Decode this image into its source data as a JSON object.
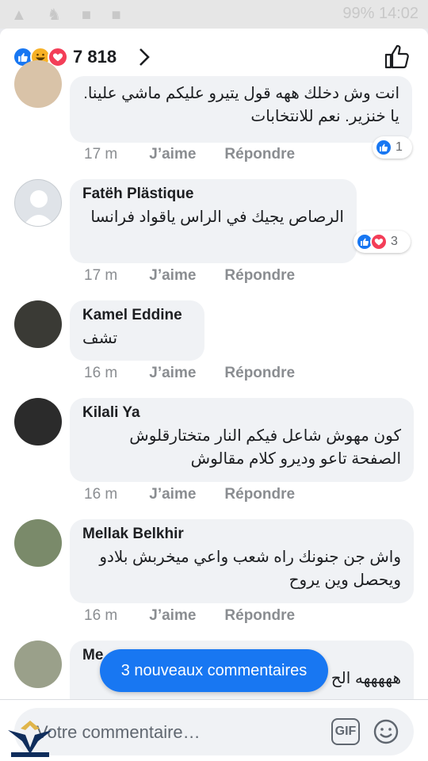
{
  "status": {
    "left_icons": "▲ ♞ ■ ■",
    "right_text": "99% 14:02"
  },
  "header": {
    "reaction_icons": [
      "like-icon",
      "haha-icon",
      "love-icon"
    ],
    "reaction_count": "7 818"
  },
  "comments": [
    {
      "name": "",
      "text": "انت وش دخلك ههه قول يتيرو عليكم ماشي علينا. يا خنزير. نعم للانتخابات",
      "time": "17 m",
      "like_label": "J’aime",
      "reply_label": "Répondre",
      "reactions": [
        "like"
      ],
      "reaction_count": "1"
    },
    {
      "name": "Fatëh Plästique",
      "text": "الرصاص يجيك في الراس ياقواد فرانسا",
      "time": "17 m",
      "like_label": "J’aime",
      "reply_label": "Répondre",
      "reactions": [
        "like",
        "love"
      ],
      "reaction_count": "3"
    },
    {
      "name": "Kamel Eddine",
      "text": "تشف",
      "time": "16 m",
      "like_label": "J’aime",
      "reply_label": "Répondre"
    },
    {
      "name": "Kilali Ya",
      "text": "كون مهوش شاعل فيكم النار متختارقلوش الصفحة تاعو وديرو كلام مقالوش",
      "time": "16 m",
      "like_label": "J’aime",
      "reply_label": "Répondre"
    },
    {
      "name": "Mellak Belkhir",
      "text": "واش جن جنونك راه شعب واعي ميخربش بلادو ويحصل وين يروح",
      "time": "16 m",
      "like_label": "J’aime",
      "reply_label": "Répondre"
    },
    {
      "name": "Me",
      "text": "هههههه الح",
      "time": "",
      "like_label": "",
      "reply_label": ""
    }
  ],
  "new_comments_pill": "3 nouveaux commentaires",
  "composer": {
    "placeholder": "Votre commentaire…",
    "gif_label": "GIF"
  },
  "colors": {
    "accent": "#1877f2",
    "bubble": "#f0f2f5",
    "meta_text": "#8a8d91",
    "love": "#f33e58",
    "haha": "#f7b125"
  }
}
